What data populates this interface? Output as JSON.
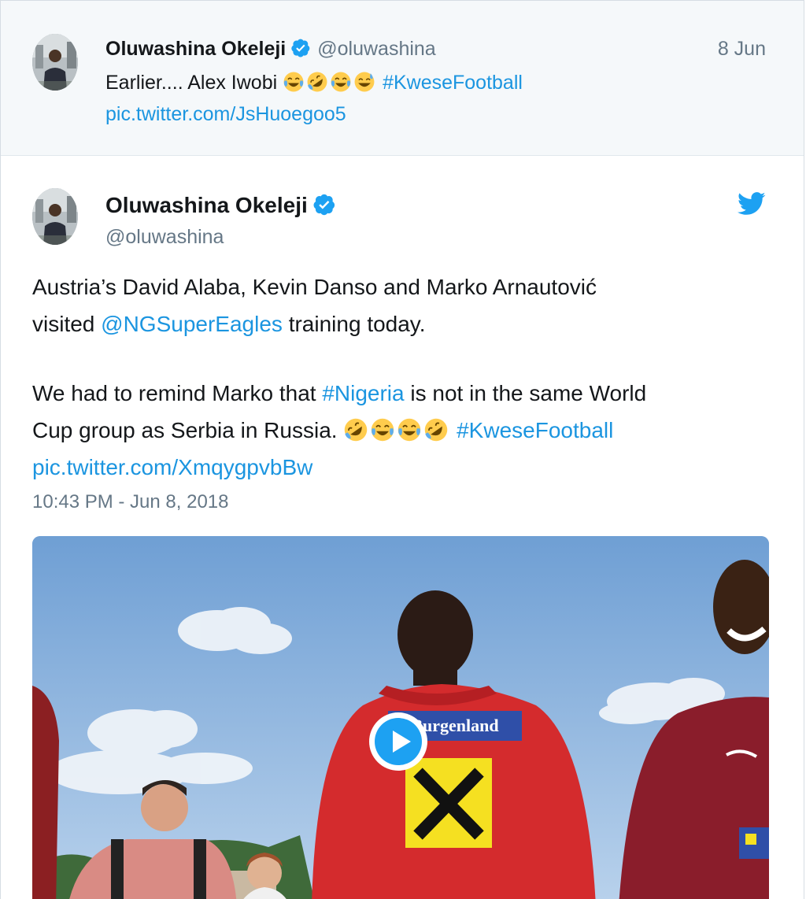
{
  "parent_tweet": {
    "author_name": "Oluwashina Okeleji",
    "handle": "@oluwashina",
    "date": "8 Jun",
    "text_prefix": "Earlier.... Alex Iwobi",
    "emojis": [
      "face-with-tears-of-joy",
      "rolling-on-the-floor-laughing",
      "face-with-tears-of-joy",
      "grinning-face-with-sweat"
    ],
    "hashtag": "#KweseFootball",
    "pic_link": "pic.twitter.com/JsHuoegoo5"
  },
  "main_tweet": {
    "author_name": "Oluwashina Okeleji",
    "handle": "@oluwashina",
    "para1": {
      "line1": "Austria’s David Alaba, Kevin Danso and Marko Arnautović",
      "line2_prefix": "visited ",
      "mention": "@NGSuperEagles",
      "line2_suffix": " training today."
    },
    "para2": {
      "part1": "We had to remind Marko that ",
      "hashtag_nigeria": "#Nigeria",
      "part2": " is not in the same World",
      "part3": "Cup group as Serbia in Russia. ",
      "emojis": [
        "rolling-on-the-floor-laughing",
        "face-with-tears-of-joy",
        "face-with-tears-of-joy",
        "rolling-on-the-floor-laughing"
      ],
      "hashtag": "#KweseFootball"
    },
    "pic_link": "pic.twitter.com/XmqygpvbBw",
    "timestamp": "10:43 PM - Jun 8, 2018",
    "video": {
      "jersey_text": "Burgenland",
      "play_button": "play-icon"
    }
  },
  "colors": {
    "link": "#1b95e0",
    "muted": "#657786",
    "text": "#14171a",
    "parent_bg": "#f5f8fa",
    "verified": "#1da1f2",
    "twitter_bird": "#1da1f2"
  }
}
